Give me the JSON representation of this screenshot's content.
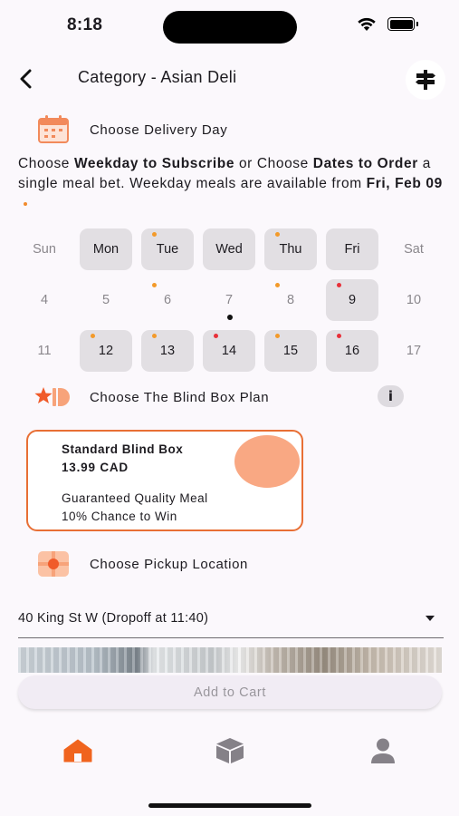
{
  "status_bar": {
    "time": "8:18"
  },
  "app_bar": {
    "title": "Category - Asian Deli"
  },
  "delivery_section": {
    "label": "Choose Delivery Day"
  },
  "intro": {
    "part1": "Choose ",
    "bold1": "Weekday to Subscribe",
    "part2": " or Choose ",
    "bold2": "Dates to Order",
    "part3": " a single meal bet. Weekday meals are available from ",
    "bold3": "Fri, Feb 09"
  },
  "calendar": {
    "weekday_header": [
      "Sun",
      "Mon",
      "Tue",
      "Wed",
      "Thu",
      "Fri",
      "Sat"
    ],
    "week1": [
      "4",
      "5",
      "6",
      "7",
      "8",
      "9",
      "10"
    ],
    "week2": [
      "11",
      "12",
      "13",
      "14",
      "15",
      "16",
      "17"
    ]
  },
  "plan_section": {
    "label": "Choose The Blind Box Plan",
    "info": "i"
  },
  "plan_card": {
    "name": "Standard Blind Box",
    "price": "13.99 CAD",
    "line1": "Guaranteed Quality Meal",
    "line2": "10% Chance to Win"
  },
  "pickup_section": {
    "label": "Choose Pickup Location"
  },
  "location_select": {
    "value": "40 King St W (Dropoff at 11:40)"
  },
  "cart": {
    "label": "Add to Cart"
  },
  "colors": {
    "accent": "#e86f35",
    "accent_light": "#f9a883",
    "marker_orange": "#f39a2a",
    "marker_red": "#e8303a"
  },
  "icons": {
    "back": "arrow-back-icon",
    "action": "signpost-icon",
    "calendar": "calendar-icon",
    "plan": "blind-box-icon",
    "pickup": "location-pin-icon",
    "nav": [
      "home-icon",
      "box-icon",
      "person-icon"
    ]
  }
}
